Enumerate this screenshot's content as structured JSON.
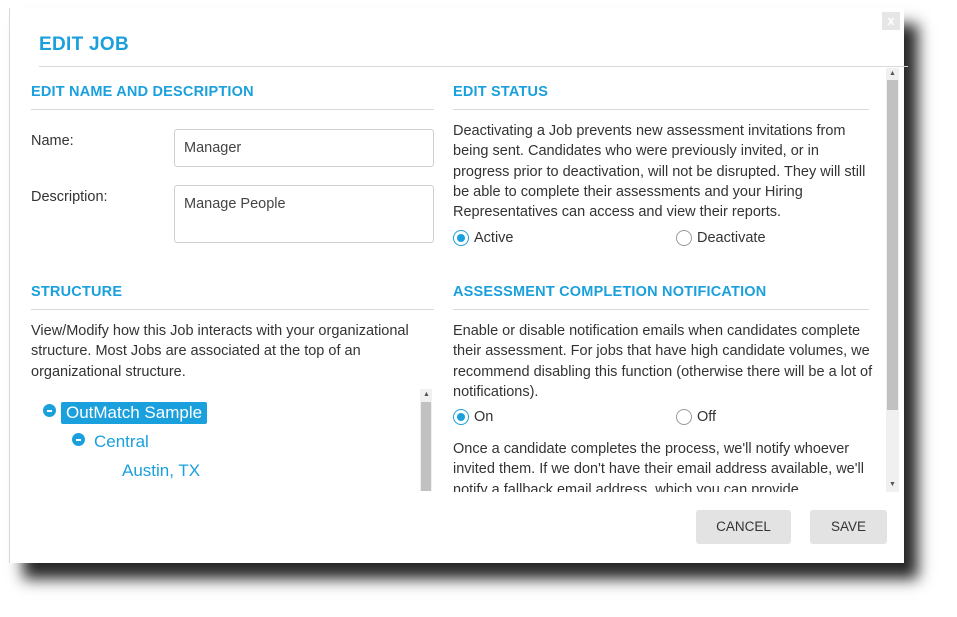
{
  "dialog": {
    "title": "EDIT JOB",
    "close_label": "x"
  },
  "edit_name": {
    "heading": "EDIT NAME AND DESCRIPTION",
    "name_label": "Name:",
    "name_value": "Manager",
    "description_label": "Description:",
    "description_value": "Manage People"
  },
  "structure": {
    "heading": "STRUCTURE",
    "description": "View/Modify how this Job interacts with your organizational structure. Most Jobs are associated at the top of an organizational structure.",
    "tree": [
      {
        "label": "OutMatch Sample",
        "level": 0,
        "expanded": true,
        "selected": true
      },
      {
        "label": "Central",
        "level": 1,
        "expanded": true,
        "selected": false
      },
      {
        "label": "Austin, TX",
        "level": 2,
        "expanded": false,
        "selected": false
      }
    ]
  },
  "edit_status": {
    "heading": "EDIT STATUS",
    "description": "Deactivating a Job prevents new assessment invitations from being sent. Candidates who were previously invited, or in progress prior to deactivation, will not be disrupted. They will still be able to complete their assessments and your Hiring Representatives can access and view their reports.",
    "options": [
      {
        "label": "Active",
        "selected": true
      },
      {
        "label": "Deactivate",
        "selected": false
      }
    ]
  },
  "notification": {
    "heading": "ASSESSMENT COMPLETION NOTIFICATION",
    "description": "Enable or disable notification emails when candidates complete their assessment. For jobs that have high candidate volumes, we recommend disabling this function (otherwise there will be a lot of notifications).",
    "options": [
      {
        "label": "On",
        "selected": true
      },
      {
        "label": "Off",
        "selected": false
      }
    ],
    "followup": "Once a candidate completes the process, we'll notify whoever invited them. If we don't have their email address available, we'll notify a fallback email address, which you can provide"
  },
  "footer": {
    "cancel_label": "CANCEL",
    "save_label": "SAVE"
  },
  "colors": {
    "accent": "#1aa0dc",
    "button_bg": "#e3e3e3"
  }
}
